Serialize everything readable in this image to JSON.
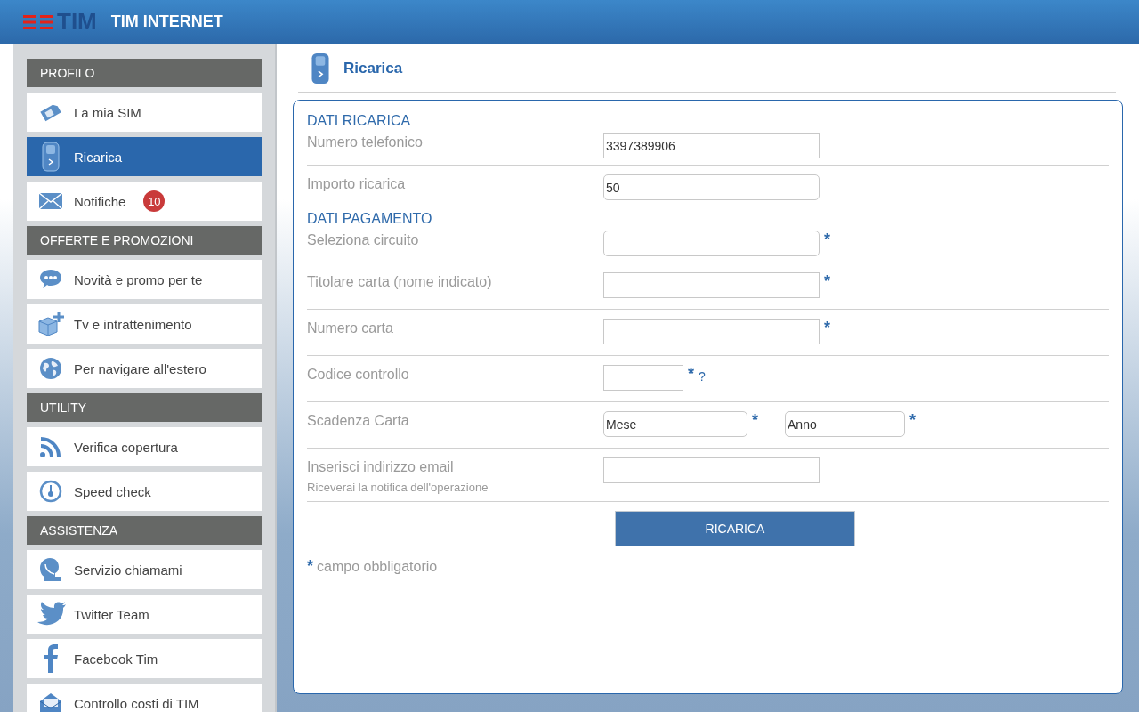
{
  "header": {
    "brand": "TIM",
    "title": "TIM INTERNET"
  },
  "sidebar": [
    {
      "heading": "PROFILO",
      "items": [
        {
          "label": "La mia SIM",
          "selected": false
        },
        {
          "label": "Ricarica",
          "selected": true
        },
        {
          "label": "Notifiche",
          "selected": false,
          "badge": "10"
        }
      ]
    },
    {
      "heading": "OFFERTE E PROMOZIONI",
      "items": [
        {
          "label": "Novità e promo per te",
          "selected": false
        },
        {
          "label": "Tv e intrattenimento",
          "selected": false
        },
        {
          "label": "Per navigare all'estero",
          "selected": false
        }
      ]
    },
    {
      "heading": "UTILITY",
      "items": [
        {
          "label": "Verifica copertura",
          "selected": false
        },
        {
          "label": "Speed check",
          "selected": false
        }
      ]
    },
    {
      "heading": "ASSISTENZA",
      "items": [
        {
          "label": "Servizio chiamami",
          "selected": false
        },
        {
          "label": "Twitter Team",
          "selected": false
        },
        {
          "label": "Facebook Tim",
          "selected": false
        },
        {
          "label": "Controllo costi di TIM",
          "selected": false
        }
      ]
    }
  ],
  "page": {
    "title": "Ricarica"
  },
  "form": {
    "sections": [
      {
        "heading": "DATI RICARICA",
        "rows": [
          {
            "label": "Numero telefonico",
            "fields": [
              {
                "kind": "input",
                "value": "3397389906"
              }
            ]
          },
          {
            "label": "Importo ricarica",
            "fields": [
              {
                "kind": "select",
                "value": "50"
              }
            ]
          }
        ]
      },
      {
        "heading": "DATI PAGAMENTO",
        "rows": [
          {
            "label": "Seleziona circuito",
            "fields": [
              {
                "kind": "select",
                "mark": "*"
              }
            ]
          },
          {
            "label": "Titolare carta (nome indicato)",
            "fields": [
              {
                "kind": "input",
                "mark": "*"
              }
            ]
          },
          {
            "label": "Numero carta",
            "fields": [
              {
                "kind": "input",
                "mark": "*"
              }
            ]
          },
          {
            "label": "Codice controllo",
            "fields": [
              {
                "kind": "code",
                "mark": "*",
                "help": "?"
              }
            ]
          },
          {
            "label": "Scadenza Carta",
            "fields": [
              {
                "kind": "month",
                "value": "Mese",
                "mark": "*"
              },
              {
                "kind": "year",
                "value": "Anno",
                "mark": "*"
              }
            ]
          },
          {
            "label": "Inserisci indirizzo email",
            "hint": "Riceverai la notifica dell'operazione",
            "fields": [
              {
                "kind": "input"
              }
            ]
          }
        ]
      }
    ],
    "submit": "RICARICA",
    "note": {
      "mark": "*",
      "text": "campo obbligatorio"
    }
  }
}
